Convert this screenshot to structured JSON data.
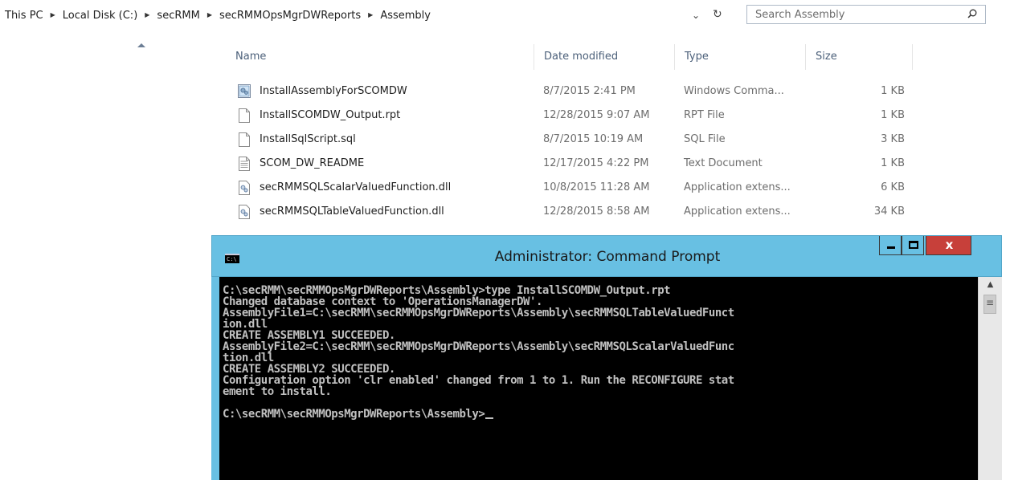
{
  "address_bar": {
    "breadcrumbs": [
      "This PC",
      "Local Disk (C:)",
      "secRMM",
      "secRMMOpsMgrDWReports",
      "Assembly"
    ],
    "dropdown_glyph": "⌄",
    "refresh_glyph": "↻",
    "search_placeholder": "Search Assembly"
  },
  "file_list": {
    "columns": [
      "Name",
      "Date modified",
      "Type",
      "Size"
    ],
    "sorted_column": "Name",
    "files": [
      {
        "name": "InstallAssemblyForSCOMDW",
        "date": "8/7/2015 2:41 PM",
        "type": "Windows Comma...",
        "size": "1 KB",
        "icon": "batch-file-icon"
      },
      {
        "name": "InstallSCOMDW_Output.rpt",
        "date": "12/28/2015 9:07 AM",
        "type": "RPT File",
        "size": "1 KB",
        "icon": "blank-file-icon"
      },
      {
        "name": "InstallSqlScript.sql",
        "date": "8/7/2015 10:19 AM",
        "type": "SQL File",
        "size": "3 KB",
        "icon": "blank-file-icon"
      },
      {
        "name": "SCOM_DW_README",
        "date": "12/17/2015 4:22 PM",
        "type": "Text Document",
        "size": "1 KB",
        "icon": "text-file-icon"
      },
      {
        "name": "secRMMSQLScalarValuedFunction.dll",
        "date": "10/8/2015 11:28 AM",
        "type": "Application extens...",
        "size": "6 KB",
        "icon": "dll-file-icon"
      },
      {
        "name": "secRMMSQLTableValuedFunction.dll",
        "date": "12/28/2015 8:58 AM",
        "type": "Application extens...",
        "size": "34 KB",
        "icon": "dll-file-icon"
      }
    ]
  },
  "command_prompt": {
    "title": "Administrator: Command Prompt",
    "icon_text": "C:\\",
    "minimize_glyph": "_",
    "close_glyph": "x",
    "lines": [
      "C:\\secRMM\\secRMMOpsMgrDWReports\\Assembly>type InstallSCOMDW_Output.rpt",
      "Changed database context to 'OperationsManagerDW'.",
      "AssemblyFile1=C:\\secRMM\\secRMMOpsMgrDWReports\\Assembly\\secRMMSQLTableValuedFunct",
      "ion.dll",
      "CREATE ASSEMBLY1 SUCCEEDED.",
      "AssemblyFile2=C:\\secRMM\\secRMMOpsMgrDWReports\\Assembly\\secRMMSQLScalarValuedFunc",
      "tion.dll",
      "CREATE ASSEMBLY2 SUCCEEDED.",
      "Configuration option 'clr enabled' changed from 1 to 1. Run the RECONFIGURE stat",
      "ement to install.",
      "",
      "C:\\secRMM\\secRMMOpsMgrDWReports\\Assembly>"
    ]
  }
}
